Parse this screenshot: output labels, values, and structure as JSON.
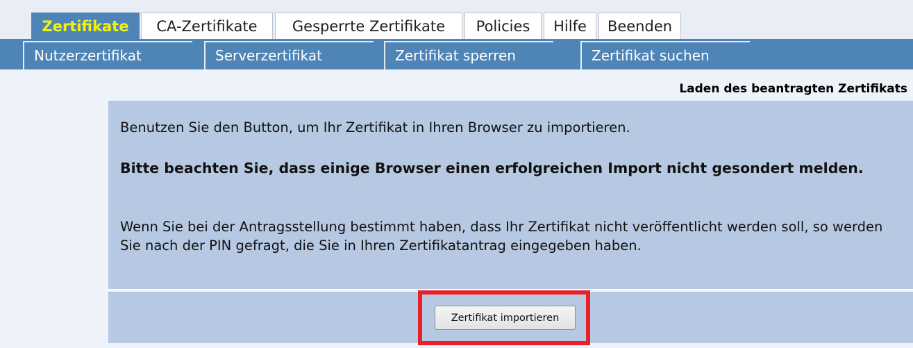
{
  "top_tabs": [
    {
      "label": "Zertifikate",
      "active": true
    },
    {
      "label": "CA-Zertifikate",
      "active": false
    },
    {
      "label": "Gesperrte Zertifikate",
      "active": false
    },
    {
      "label": "Policies",
      "active": false
    },
    {
      "label": "Hilfe",
      "active": false
    },
    {
      "label": "Beenden",
      "active": false
    }
  ],
  "sub_tabs": [
    {
      "label": "Nutzerzertifikat"
    },
    {
      "label": "Serverzertifikat"
    },
    {
      "label": "Zertifikat sperren"
    },
    {
      "label": "Zertifikat suchen"
    }
  ],
  "page": {
    "heading": "Laden des beantragten Zertifikats",
    "intro": "Benutzen Sie den Button, um Ihr Zertifikat in Ihren Browser zu importieren.",
    "notice": "Bitte beachten Sie, dass einige Browser einen erfolgreichen Import nicht gesondert melden.",
    "pin_info": "Wenn Sie bei der Antragsstellung bestimmt haben, dass Ihr Zertifikat nicht veröffentlicht werden soll, so werden Sie nach der PIN gefragt, die Sie in Ihren Zertifikatantrag eingegeben haben.",
    "import_button": "Zertifikat importieren"
  },
  "colors": {
    "accent": "#4f85b6",
    "active_tab_text": "#f4f400",
    "panel": "#b7c9e2",
    "highlight": "#e8202a"
  }
}
